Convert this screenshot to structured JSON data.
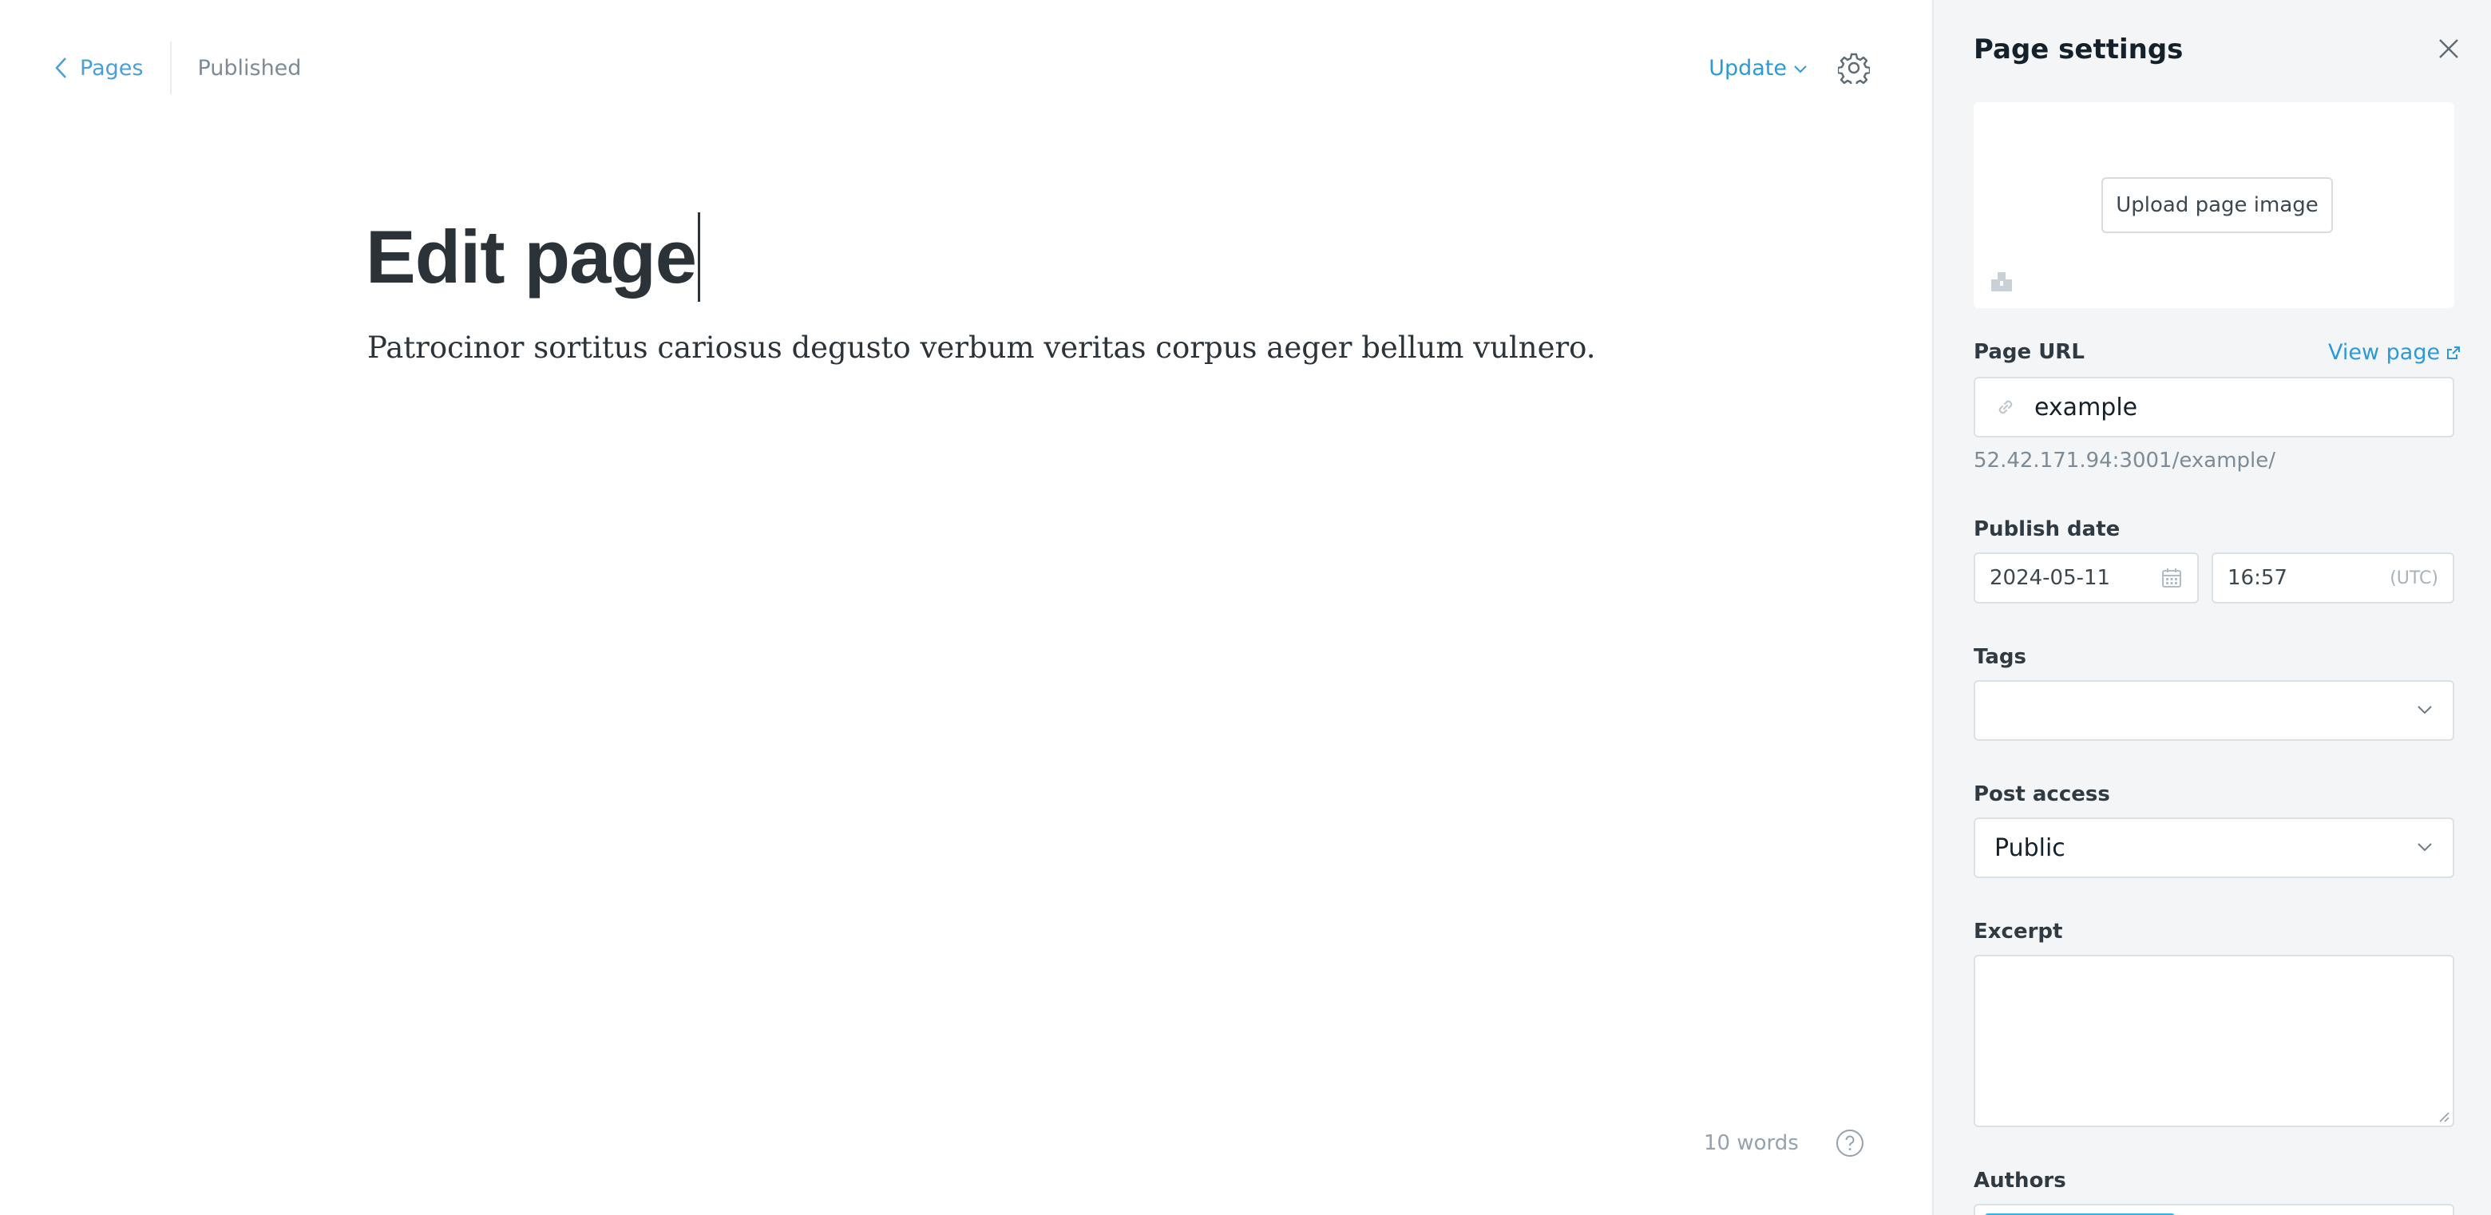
{
  "editor": {
    "back_label": "Pages",
    "status": "Published",
    "update_label": "Update",
    "title": "Edit page",
    "body": "Patrocinor sortitus cariosus degusto verbum veritas corpus aeger bellum vulnero.",
    "word_count": "10 words",
    "icons": [
      "chevron-left-icon",
      "chevron-down-icon",
      "gear-icon",
      "help-icon"
    ]
  },
  "settings": {
    "title": "Page settings",
    "upload_label": "Upload page image",
    "page_url_label": "Page URL",
    "view_page_label": "View page",
    "url_value": "example",
    "url_hint": "52.42.171.94:3001/example/",
    "publish_date_label": "Publish date",
    "date_value": "2024-05-11",
    "time_value": "16:57",
    "timezone": "(UTC)",
    "tags_label": "Tags",
    "tags_value": "",
    "access_label": "Post access",
    "access_value": "Public",
    "excerpt_label": "Excerpt",
    "excerpt_value": "",
    "authors_label": "Authors",
    "icons": [
      "close-icon",
      "image-icon",
      "link-icon",
      "external-link-icon",
      "calendar-icon",
      "chevron-down-icon"
    ]
  },
  "colors": {
    "accent": "#2b9ad6",
    "panel_bg": "#f4f5f6",
    "text_dark": "#15212a",
    "muted": "#7d8b97",
    "author_pill": "#35b4e4"
  }
}
